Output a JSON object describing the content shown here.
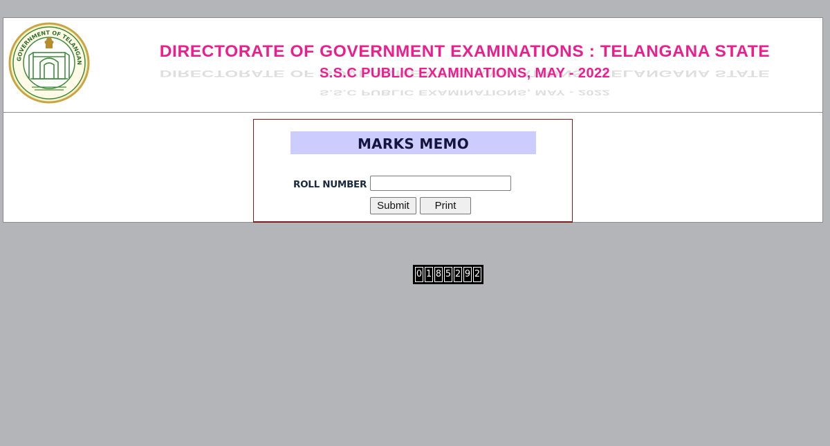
{
  "header": {
    "emblem_name": "telangana-state-emblem",
    "emblem_text": "GOVERNMENT OF TELANGANA",
    "title": "DIRECTORATE OF GOVERNMENT EXAMINATIONS : TELANGANA STATE",
    "subtitle": "S.S.C PUBLIC EXAMINATIONS, MAY - 2022",
    "title_color": "#ec1e8e"
  },
  "form": {
    "heading": "MARKS MEMO",
    "roll_label": "ROLL NUMBER",
    "roll_value": "",
    "roll_placeholder": "",
    "submit_label": "Submit",
    "print_label": "Print",
    "heading_bg": "#ccccff",
    "border_color": "#7b1b1b"
  },
  "counter": {
    "digits": [
      "0",
      "1",
      "8",
      "5",
      "2",
      "9",
      "2"
    ]
  },
  "colors": {
    "background": "#b4b5b9",
    "panel": "#ffffff"
  }
}
